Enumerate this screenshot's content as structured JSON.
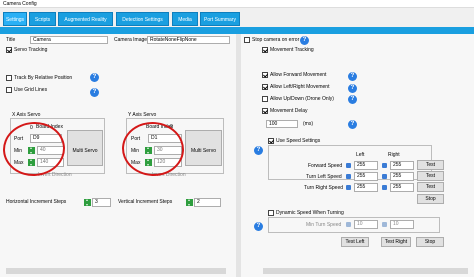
{
  "window": {
    "title": "Camera Config"
  },
  "tabs": [
    "Settings",
    "Scripts",
    "Augmented Reality",
    "Detection Settings",
    "Media",
    "Port Summary"
  ],
  "left": {
    "title_label": "Title",
    "title_value": "Camera",
    "camera_image_label": "Camera Image",
    "camera_image_value": "RotateNoneFlipNone",
    "servo_tracking": "Servo Tracking",
    "track_relative": "Track By Relative Position",
    "use_grid_lines": "Use Grid Lines",
    "x_axis": {
      "title": "X Axis Servo",
      "board_index_label": "Board Index",
      "board_index": "0",
      "port_label": "Port",
      "port": "D9",
      "min_label": "Min",
      "min": "40",
      "max_label": "Max",
      "max": "140",
      "multi_servo": "Multi Servo",
      "invert": "Invert Direction"
    },
    "y_axis": {
      "title": "Y Axis Servo",
      "board_index_label": "Board Index",
      "board_index": "0",
      "port_label": "Port",
      "port": "D1",
      "min_label": "Min",
      "min": "30",
      "max_label": "Max",
      "max": "120",
      "multi_servo": "Multi Servo",
      "invert": "Invert Direction"
    },
    "horiz_increment_label": "Horizontal Increment Steps",
    "horiz_increment": "3",
    "vert_increment_label": "Vertical Increment Steps",
    "vert_increment": "2"
  },
  "right": {
    "stop_camera": "Stop camera on error",
    "movement_tracking": "Movement Tracking",
    "allow_forward": "Allow Forward Movement",
    "allow_left_right": "Allow Left/Right Movement",
    "allow_up_down": "Allow Up/Down (Drone Only)",
    "movement_delay": "Movement Delay",
    "delay_value": "100",
    "delay_unit": "(ms)",
    "use_speed": "Use Speed Settings",
    "left_header": "Left",
    "right_header": "Right",
    "forward_speed": "Forward Speed",
    "forward_left": "255",
    "forward_right": "255",
    "turn_left_speed": "Turn Left Speed",
    "turn_left_left": "255",
    "turn_left_right": "255",
    "turn_right_speed": "Turn Right Speed",
    "turn_right_left": "255",
    "turn_right_right": "255",
    "test": "Test",
    "stop": "Stop",
    "dynamic_speed": "Dynamic Speed When Turning",
    "min_turn_speed": "Min Turn Speed",
    "min_turn_left": "10",
    "min_turn_right": "10",
    "test_left": "Test Left",
    "test_right": "Test Right",
    "stop_btn": "Stop"
  }
}
